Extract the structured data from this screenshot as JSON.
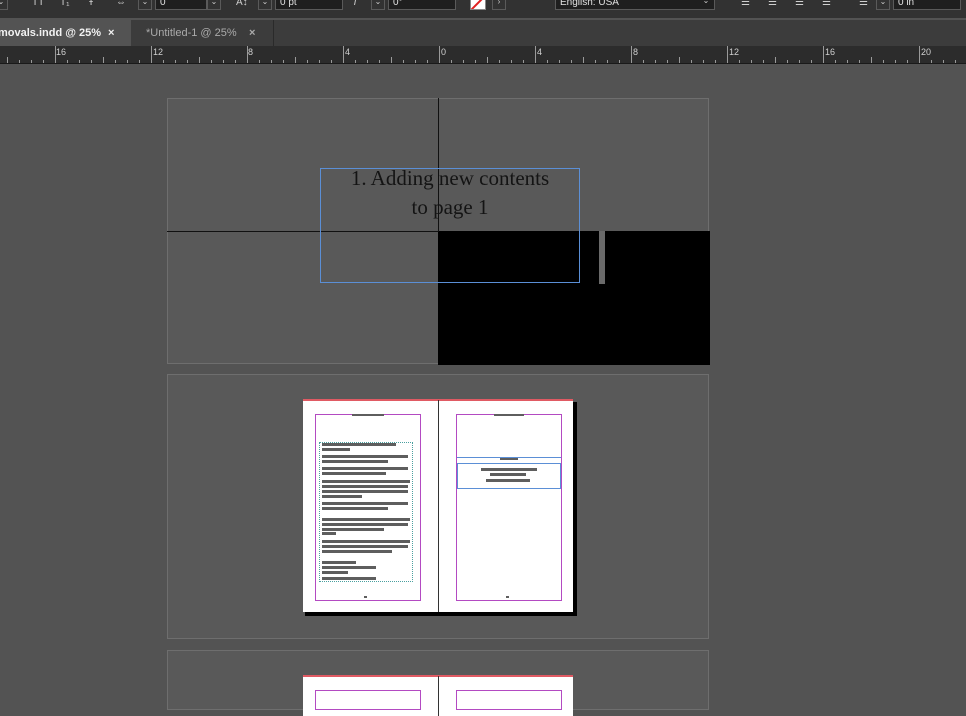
{
  "toolbar": {
    "stroke_weight": "0 pt",
    "kerning_value": "0",
    "skew_value": "0°",
    "language": "English: USA",
    "indent_value": "0 in"
  },
  "tabs": [
    {
      "label": "movals.indd @ 25%",
      "close": "×"
    },
    {
      "label": "*Untitled-1 @ 25%",
      "close": "×"
    }
  ],
  "ruler": {
    "labels": [
      "16",
      "12",
      "8",
      "4",
      "0",
      "4",
      "8",
      "12",
      "16",
      "20"
    ]
  },
  "document": {
    "heading_line1": "1. Adding new contents",
    "heading_line2": "to page 1"
  },
  "colors": {
    "app_bg": "#535353",
    "toolbar_bg": "#323232",
    "frame_blue": "#5b8fd6",
    "margin_magenta": "#b34ac2",
    "bleed_red": "#e05a63"
  }
}
